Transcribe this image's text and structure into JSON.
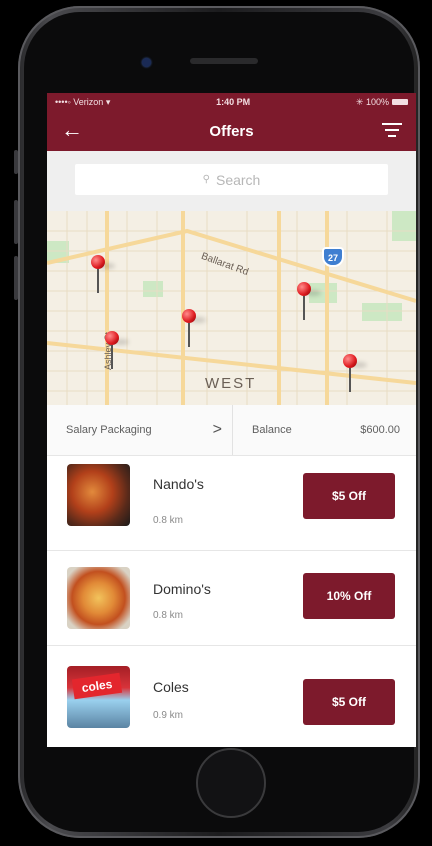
{
  "status_bar": {
    "carrier": "••••◦ Verizon ▾",
    "time": "1:40 PM",
    "battery": "✳ 100%"
  },
  "nav": {
    "title": "Offers",
    "back_icon": "back-arrow-icon",
    "filter_icon": "filter-icon"
  },
  "search": {
    "placeholder": "Search"
  },
  "map": {
    "street_labels": [
      "Ballarat Rd",
      "Ashley St",
      "WEST"
    ],
    "highway_shield": "27"
  },
  "salary": {
    "label": "Salary Packaging",
    "chevron": ">"
  },
  "balance": {
    "label": "Balance",
    "value": "$600.00"
  },
  "offers": [
    {
      "name": "Nando's",
      "distance": "0.8 km",
      "button": "$5 Off"
    },
    {
      "name": "Domino's",
      "distance": "0.8 km",
      "button": "10% Off"
    },
    {
      "name": "Coles",
      "distance": "0.9 km",
      "button": "$5 Off"
    }
  ],
  "colors": {
    "brand": "#7d1a2c",
    "pin": "#e0191e",
    "highway": "#3f7fd1"
  }
}
